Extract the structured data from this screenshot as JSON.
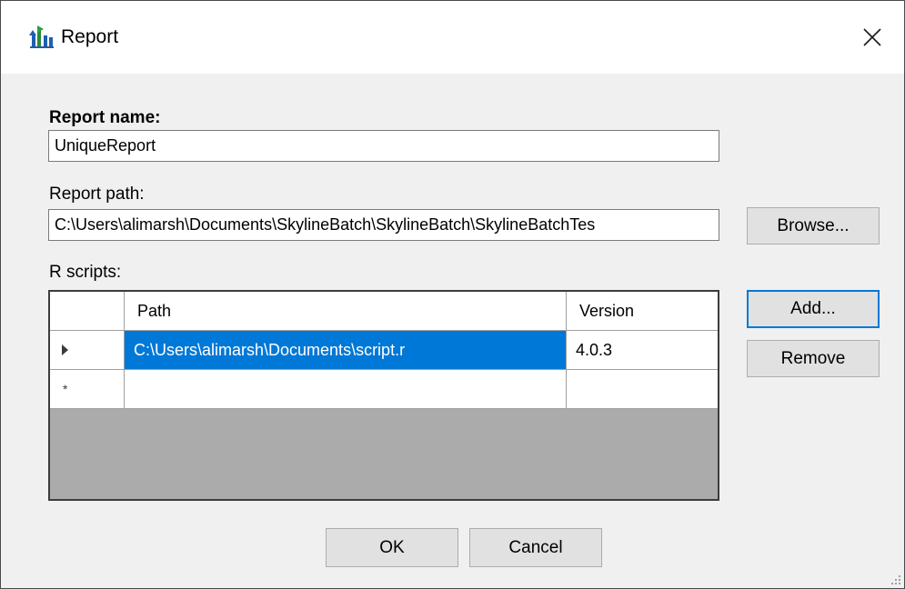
{
  "window": {
    "title": "Report",
    "icon": "skyline-batch-icon",
    "close_icon": "close-icon"
  },
  "form": {
    "report_name_label": "Report name:",
    "report_name_value": "UniqueReport",
    "report_path_label": "Report path:",
    "report_path_value": "C:\\Users\\alimarsh\\Documents\\SkylineBatch\\SkylineBatch\\SkylineBatchTes",
    "browse_label": "Browse...",
    "r_scripts_label": "R scripts:"
  },
  "scripts_grid": {
    "columns": [
      "Path",
      "Version"
    ],
    "rows": [
      {
        "indicator": "current-row-arrow",
        "path": "C:\\Users\\alimarsh\\Documents\\script.r",
        "version": "4.0.3",
        "selected_column": "path"
      },
      {
        "indicator": "*",
        "path": "",
        "version": ""
      }
    ]
  },
  "side_buttons": {
    "add_label": "Add...",
    "remove_label": "Remove"
  },
  "footer": {
    "ok_label": "OK",
    "cancel_label": "Cancel"
  },
  "colors": {
    "selection": "#0078d7",
    "focus_border": "#0078d7",
    "grid_empty_area": "#ababab",
    "dialog_background": "#f0f0f0"
  }
}
